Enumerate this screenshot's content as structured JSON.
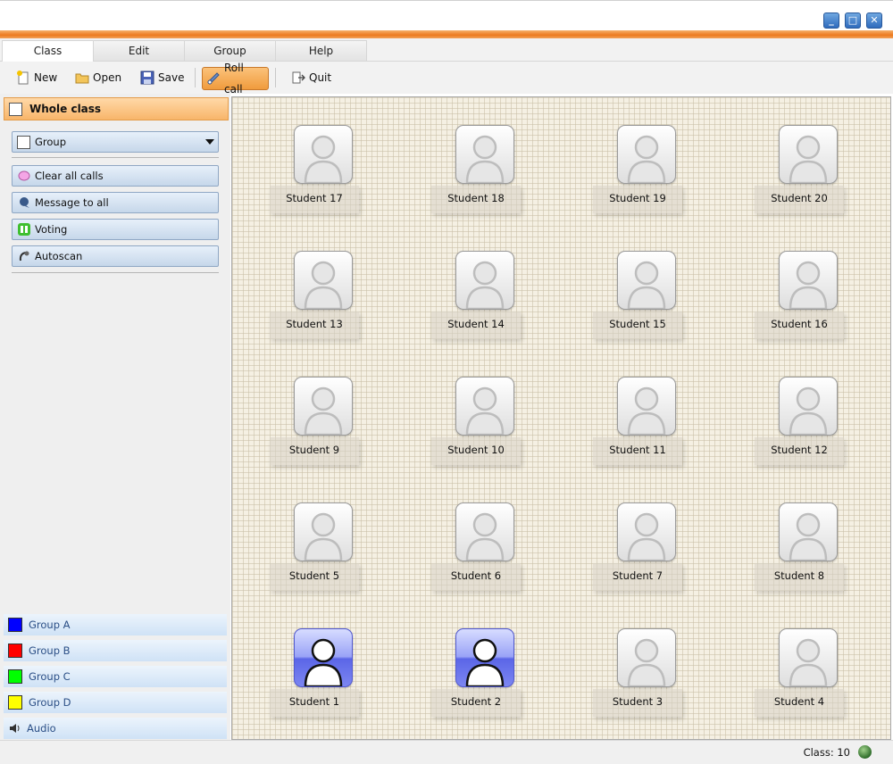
{
  "window": {
    "controls": [
      {
        "name": "minimize",
        "glyph": "_"
      },
      {
        "name": "maximize",
        "glyph": "□"
      },
      {
        "name": "close",
        "glyph": "✕"
      }
    ]
  },
  "tabs": [
    {
      "label": "Class",
      "active": true
    },
    {
      "label": "Edit",
      "active": false
    },
    {
      "label": "Group",
      "active": false
    },
    {
      "label": "Help",
      "active": false
    }
  ],
  "toolbar": {
    "new_label": "New",
    "open_label": "Open",
    "save_label": "Save",
    "rollcall_label": "Roll call",
    "quit_label": "Quit"
  },
  "sidebar": {
    "whole_class": "Whole class",
    "group_dropdown": "Group",
    "actions": [
      {
        "label": "Clear all calls",
        "icon": "clear-calls-icon"
      },
      {
        "label": "Message to all",
        "icon": "message-icon"
      },
      {
        "label": "Voting",
        "icon": "voting-icon"
      },
      {
        "label": "Autoscan",
        "icon": "autoscan-icon"
      }
    ],
    "groups": [
      {
        "label": "Group A",
        "color": "#0000ff"
      },
      {
        "label": "Group B",
        "color": "#ff0000"
      },
      {
        "label": "Group C",
        "color": "#00ff00"
      },
      {
        "label": "Group D",
        "color": "#ffff00"
      }
    ],
    "audio_label": "Audio"
  },
  "students": [
    {
      "name": "Student 17",
      "selected": false
    },
    {
      "name": "Student 18",
      "selected": false
    },
    {
      "name": "Student 19",
      "selected": false
    },
    {
      "name": "Student 20",
      "selected": false
    },
    {
      "name": "Student 13",
      "selected": false
    },
    {
      "name": "Student 14",
      "selected": false
    },
    {
      "name": "Student 15",
      "selected": false
    },
    {
      "name": "Student 16",
      "selected": false
    },
    {
      "name": "Student 9",
      "selected": false
    },
    {
      "name": "Student 10",
      "selected": false
    },
    {
      "name": "Student 11",
      "selected": false
    },
    {
      "name": "Student 12",
      "selected": false
    },
    {
      "name": "Student 5",
      "selected": false
    },
    {
      "name": "Student 6",
      "selected": false
    },
    {
      "name": "Student 7",
      "selected": false
    },
    {
      "name": "Student 8",
      "selected": false
    },
    {
      "name": "Student 1",
      "selected": true
    },
    {
      "name": "Student 2",
      "selected": true
    },
    {
      "name": "Student 3",
      "selected": false
    },
    {
      "name": "Student 4",
      "selected": false
    }
  ],
  "status": {
    "class_text": "Class: 10"
  }
}
